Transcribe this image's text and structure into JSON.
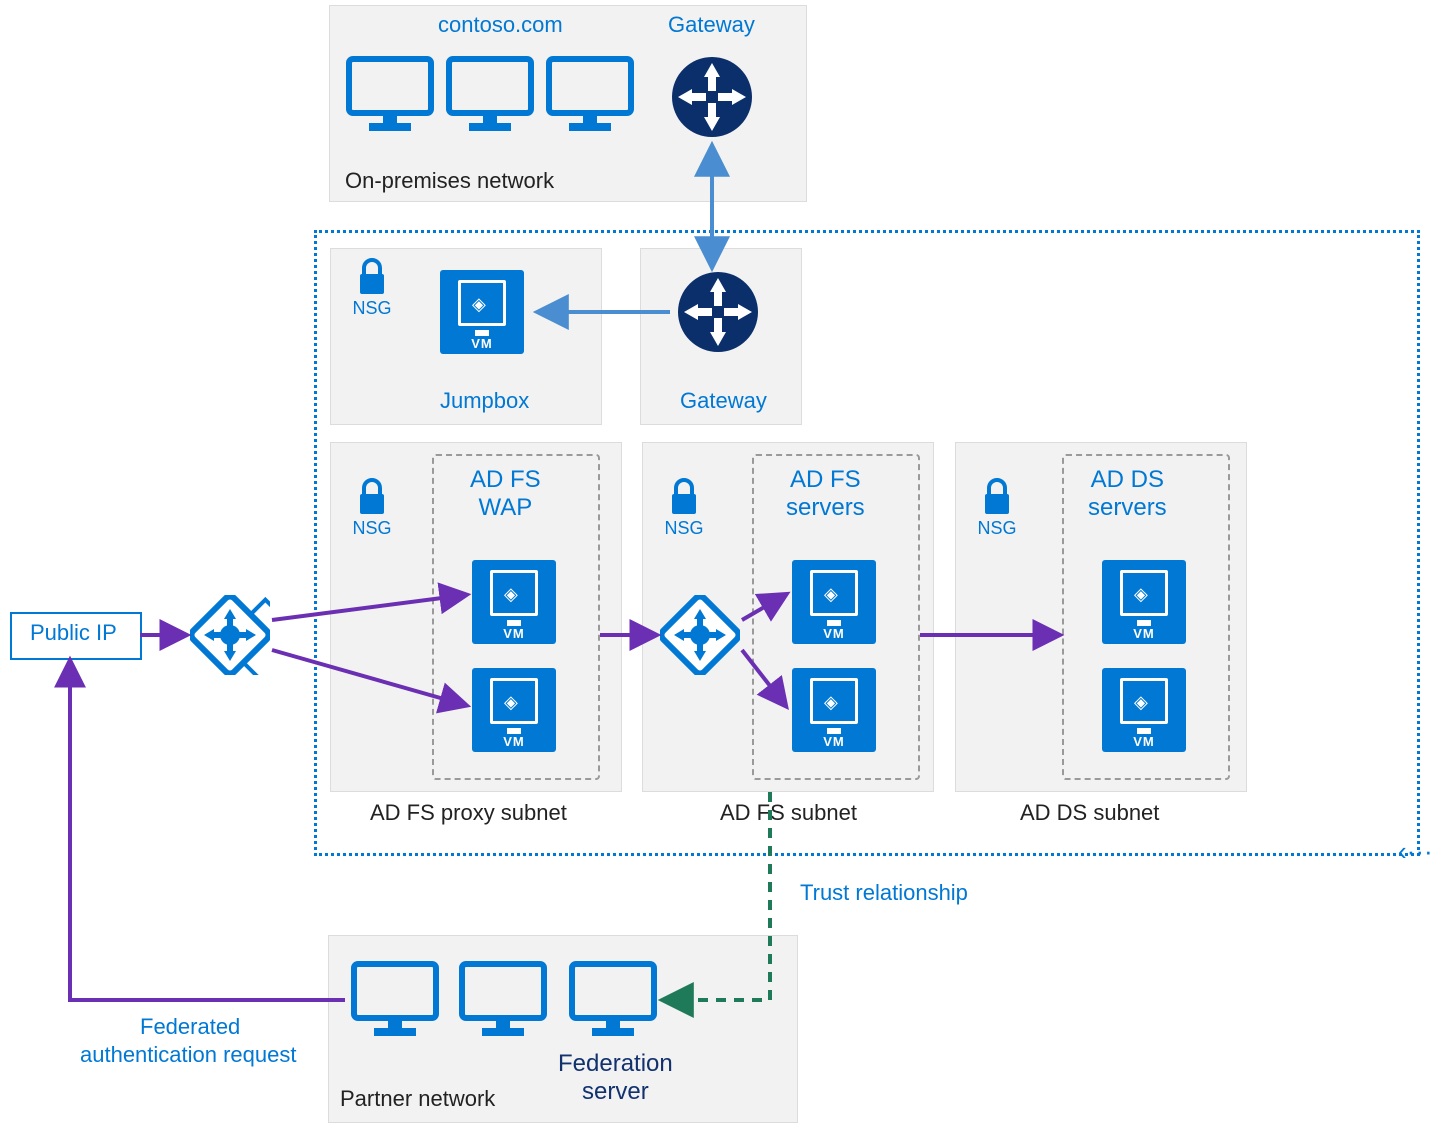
{
  "onprem": {
    "title": "On-premises network",
    "domain": "contoso.com",
    "gateway_label": "Gateway"
  },
  "vnet": {
    "jumpbox": {
      "nsg": "NSG",
      "title": "Jumpbox"
    },
    "gateway": {
      "title": "Gateway"
    },
    "adfs_proxy": {
      "nsg": "NSG",
      "set_title": "AD FS\nWAP",
      "subnet": "AD FS proxy subnet"
    },
    "adfs": {
      "nsg": "NSG",
      "set_title": "AD FS\nservers",
      "subnet": "AD FS subnet"
    },
    "adds": {
      "nsg": "NSG",
      "set_title": "AD DS\nservers",
      "subnet": "AD DS subnet"
    }
  },
  "public_ip": {
    "label": "Public IP"
  },
  "partner": {
    "title": "Partner network",
    "fed_server": "Federation\nserver"
  },
  "annotations": {
    "trust": "Trust relationship",
    "fed_request_l1": "Federated",
    "fed_request_l2": "authentication request"
  },
  "vm_tag": "VM"
}
